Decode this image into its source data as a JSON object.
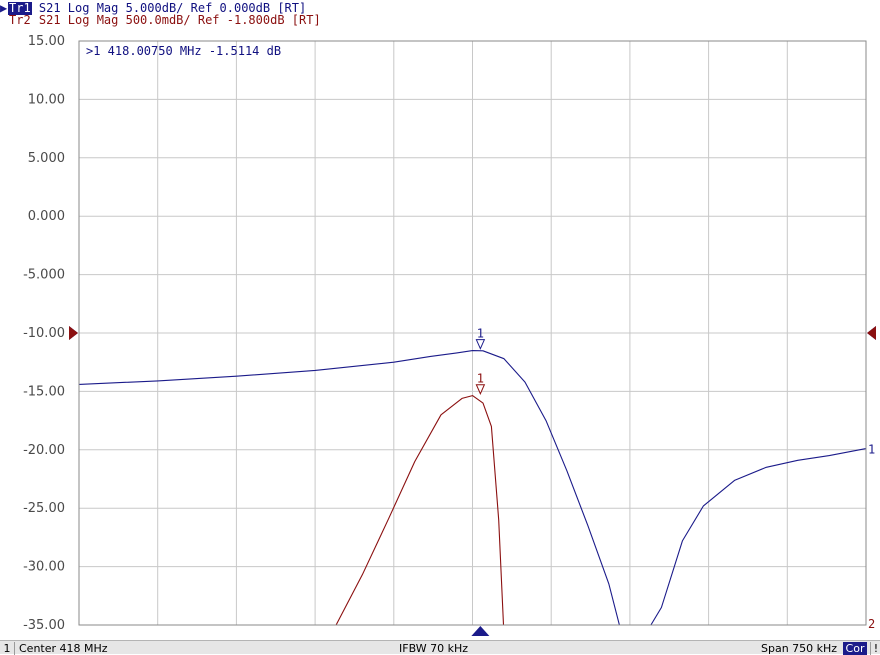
{
  "header": {
    "tr1_tag": "Tr1",
    "tr1_text": " S21 Log Mag 5.000dB/ Ref 0.000dB [RT]",
    "tr2_tag": "Tr2",
    "tr2_text": " S21 Log Mag 500.0mdB/ Ref -1.800dB [RT]"
  },
  "marker_readout": ">1  418.00750 MHz -1.5114 dB",
  "status": {
    "channel": "1",
    "center": "Center 418 MHz",
    "ifbw": "IFBW 70 kHz",
    "span": "Span 750 kHz",
    "cor": "Cor",
    "end": "!"
  },
  "colors": {
    "trace1": "#1b1b8a",
    "trace2": "#8b1010",
    "grid": "#c8c8c8",
    "axis_text": "#4a4a4a"
  },
  "chart_data": {
    "type": "line",
    "x_unit": "MHz",
    "x_range": [
      417.625,
      418.375
    ],
    "center_mhz": 418,
    "span_khz": 750,
    "y_tick_labels": [
      "15.00",
      "10.00",
      "5.000",
      "0.000",
      "-5.000",
      "-10.00",
      "-15.00",
      "-20.00",
      "-25.00",
      "-30.00",
      "-35.00"
    ],
    "ylim": [
      -35,
      15
    ],
    "grid": true,
    "series": [
      {
        "name": "Tr1",
        "scale_db_per_div": 5.0,
        "ref_db": 0.0,
        "end_label": "1",
        "x": [
          417.625,
          417.7,
          417.775,
          417.85,
          417.925,
          417.96,
          417.985,
          418.0,
          418.01,
          418.03,
          418.05,
          418.07,
          418.09,
          418.11,
          418.13,
          418.14,
          418.15,
          418.158,
          418.163,
          418.17,
          418.18,
          418.2,
          418.22,
          418.25,
          418.28,
          418.31,
          418.34,
          418.375
        ],
        "y": [
          -4.4,
          -4.1,
          -3.7,
          -3.2,
          -2.5,
          -2.0,
          -1.7,
          -1.51,
          -1.52,
          -2.2,
          -4.2,
          -7.5,
          -11.8,
          -16.5,
          -21.5,
          -25.0,
          -29.0,
          -32.3,
          -31.5,
          -28.0,
          -23.5,
          -17.8,
          -14.8,
          -12.6,
          -11.5,
          -10.9,
          -10.5,
          -9.9
        ]
      },
      {
        "name": "Tr2",
        "scale_db_per_div": 0.5,
        "ref_db": -1.8,
        "end_label": "2",
        "x": [
          417.625,
          417.87,
          417.895,
          417.92,
          417.945,
          417.97,
          417.99,
          418.0,
          418.01,
          418.018,
          418.025,
          418.0295,
          418.375
        ],
        "y": [
          -4.3,
          -4.3,
          -3.87,
          -3.39,
          -2.9,
          -2.5,
          -2.36,
          -2.336,
          -2.4,
          -2.6,
          -3.4,
          -4.3,
          -4.3
        ]
      }
    ],
    "markers": [
      {
        "series": "Tr1",
        "label": "1",
        "x": 418.0075,
        "y": -1.5114
      },
      {
        "series": "Tr2",
        "label": "1",
        "x": 418.0075,
        "y": -2.337
      }
    ]
  }
}
